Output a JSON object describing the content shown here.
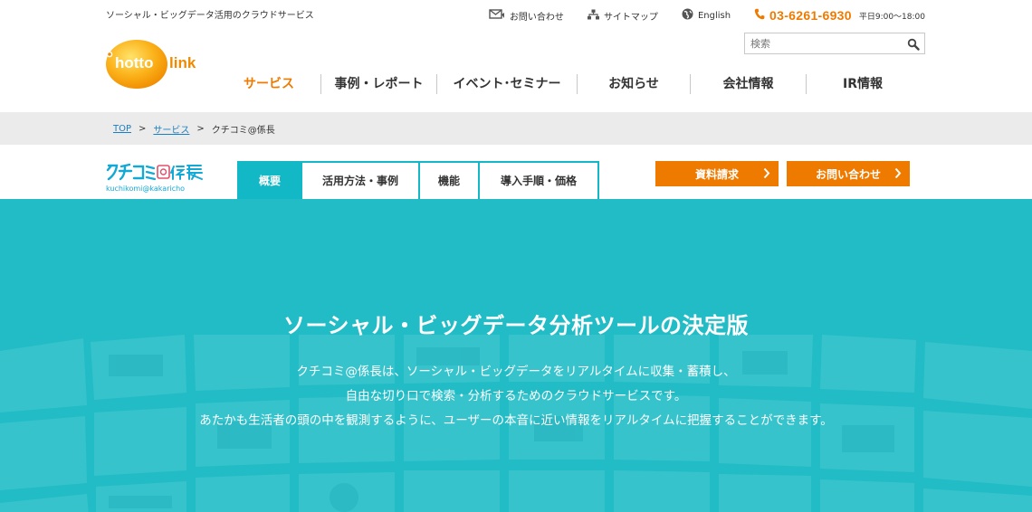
{
  "header": {
    "tagline": "ソーシャル・ビッグデータ活用のクラウドサービス",
    "utility": {
      "contact_label": "お問い合わせ",
      "sitemap_label": "サイトマップ",
      "english_label": "English",
      "phone": "03-6261-6930",
      "hours": "平日9:00〜18:00"
    },
    "search": {
      "placeholder": "検索"
    },
    "logo": {
      "text": "hotto link",
      "icon": "hottolink-logo"
    }
  },
  "nav": {
    "items": [
      {
        "label": "サービス",
        "active": true
      },
      {
        "label": "事例・レポート"
      },
      {
        "label": "イベント･セミナー"
      },
      {
        "label": "お知らせ"
      },
      {
        "label": "会社情報"
      },
      {
        "label": "IR情報"
      }
    ]
  },
  "breadcrumb": {
    "top": "TOP",
    "service": "サービス",
    "current": "クチコミ@係長",
    "separator": ">"
  },
  "product": {
    "logo_text": "クチコミ@係長",
    "logo_subtext": "kuchikomi@kakaricho",
    "tabs": [
      {
        "label": "概要",
        "active": true
      },
      {
        "label": "活用方法・事例"
      },
      {
        "label": "機能"
      },
      {
        "label": "導入手順・価格"
      }
    ],
    "cta": {
      "materials_label": "資料請求",
      "contact_label": "お問い合わせ"
    }
  },
  "hero": {
    "title": "ソーシャル・ビッグデータ分析ツールの決定版",
    "lines": [
      "クチコミ@係長は、ソーシャル・ビッグデータをリアルタイムに収集・蓄積し、",
      "自由な切り口で検索・分析するためのクラウドサービスです。",
      "あたかも生活者の頭の中を観測するように、ユーザーの本音に近い情報をリアルタイムに把握することができます。"
    ]
  },
  "colors": {
    "accent_orange": "#ef7a00",
    "teal": "#12b8c5",
    "hero_bg": "#22bcc6",
    "link": "#1a7fc2"
  }
}
